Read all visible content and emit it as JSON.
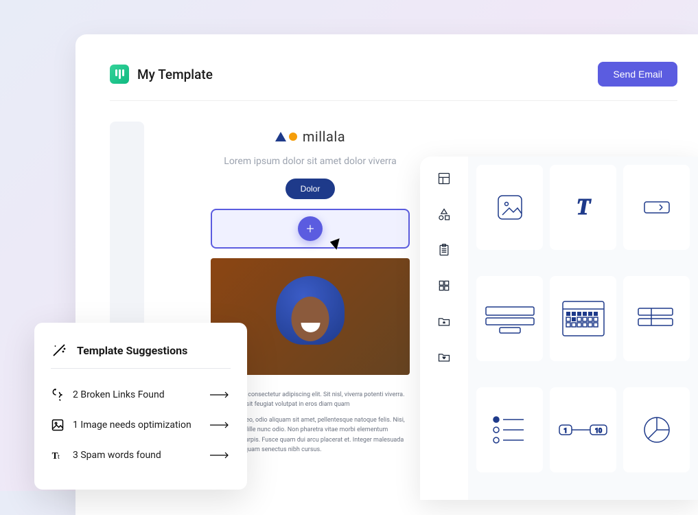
{
  "header": {
    "title": "My Template",
    "send_label": "Send Email"
  },
  "canvas": {
    "brand_name": "millala",
    "subtitle": "Lorem ipsum dolor sit amet dolor viverra",
    "button_label": "Dolor",
    "paragraph1": "olor sit amet, consectetur adipiscing elit. Sit nisl, viverra potenti viverra. Nulla viverra sit feugiat volutpat in eros diam quam",
    "paragraph2": "ipsum justo leo, odio aliquam sit amet, pellentesque natoque felis. Nisi, enim purus idille nunc odio. Non pharetra vitae morbi elementum porttitor ite turpis. Fusce quam dui arcu placerat et. Integer malesuada nibh i. Vitae quam senectus nibh cursus."
  },
  "suggestions": {
    "title": "Template Suggestions",
    "items": [
      {
        "label": "2 Broken Links Found"
      },
      {
        "label": "1 Image needs optimization"
      },
      {
        "label": "3 Spam words found"
      }
    ]
  },
  "panel": {
    "nav": [
      "layout",
      "shapes",
      "clipboard",
      "grid",
      "folder-star",
      "folder-heart"
    ],
    "tiles": [
      "image",
      "text",
      "input",
      "columns",
      "calendar",
      "table",
      "bullets",
      "range",
      "chart"
    ]
  }
}
